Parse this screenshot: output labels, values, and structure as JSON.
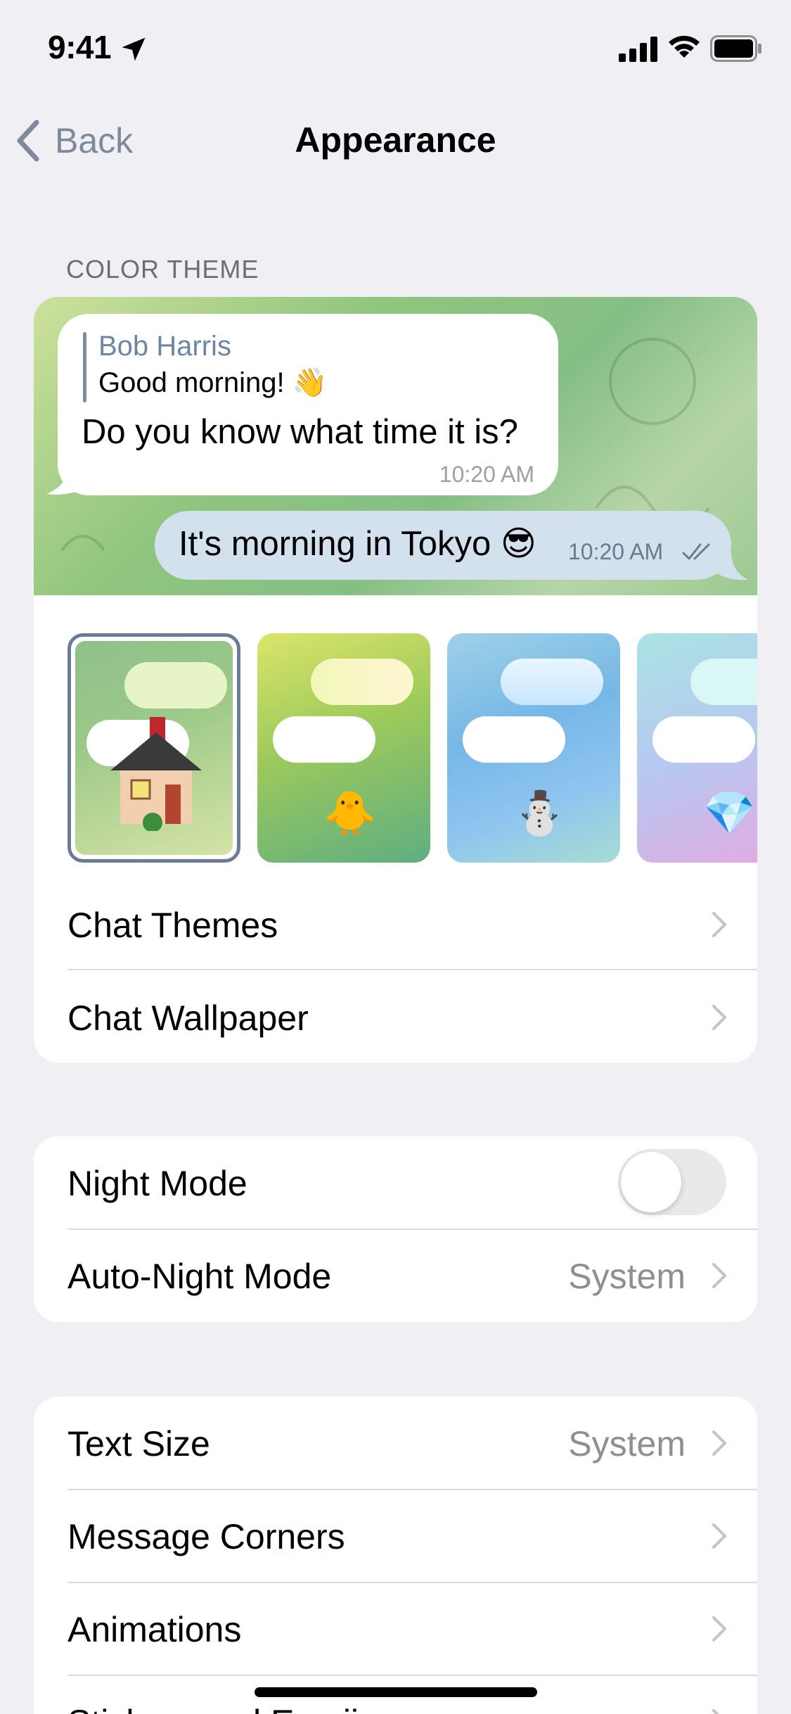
{
  "status_bar": {
    "time": "9:41"
  },
  "nav": {
    "back_label": "Back",
    "title": "Appearance"
  },
  "color_theme": {
    "section_title": "COLOR THEME",
    "preview": {
      "reply_name": "Bob Harris",
      "reply_text": "Good morning! 👋",
      "incoming_message": "Do you know what time it is?",
      "incoming_time": "10:20 AM",
      "outgoing_message": "It's morning in Tokyo 😎",
      "outgoing_time": "10:20 AM"
    },
    "themes": [
      {
        "emoji": "🏠",
        "selected": true
      },
      {
        "emoji": "🐥",
        "selected": false
      },
      {
        "emoji": "⛄",
        "selected": false
      },
      {
        "emoji": "💎",
        "selected": false
      }
    ],
    "rows": [
      {
        "label": "Chat Themes"
      },
      {
        "label": "Chat Wallpaper"
      }
    ]
  },
  "night": {
    "night_mode_label": "Night Mode",
    "night_mode_on": false,
    "auto_night_label": "Auto-Night Mode",
    "auto_night_value": "System"
  },
  "text_settings": {
    "text_size_label": "Text Size",
    "text_size_value": "System",
    "message_corners_label": "Message Corners",
    "animations_label": "Animations",
    "stickers_label": "Stickers and Emoji"
  },
  "colors": {
    "accent": "#7e8a9a",
    "outgoing_bubble": "#d3e0ee"
  }
}
